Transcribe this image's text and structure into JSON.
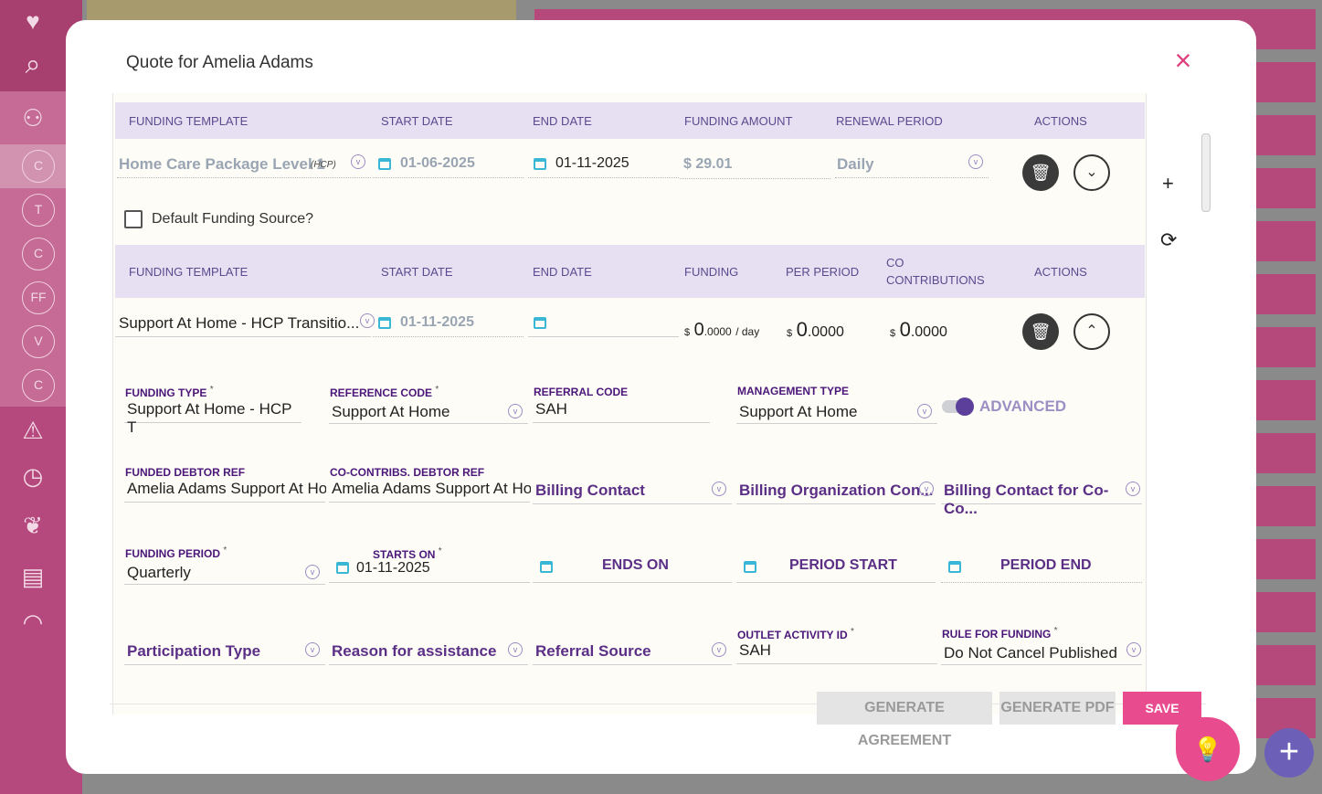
{
  "modal": {
    "title": "Quote for Amelia Adams",
    "close_icon": "×"
  },
  "sidebar": {
    "heart_icon": "♥",
    "search_icon": "⌕",
    "people_icon": "⚇",
    "circles": [
      "C",
      "T",
      "C",
      "FF",
      "V",
      "C"
    ],
    "warning_icon": "⚠",
    "clock_icon": "◷",
    "hearts_icon": "❦",
    "chat_icon": "▤",
    "gauge_icon": "◠"
  },
  "funding_header_1": {
    "template": "FUNDING TEMPLATE",
    "start": "START DATE",
    "end": "END DATE",
    "amount": "FUNDING AMOUNT",
    "renewal": "RENEWAL PERIOD",
    "actions": "ACTIONS"
  },
  "funding_row_1": {
    "template": "Home Care Package Level 1",
    "template_tag": "(HCP)",
    "start_date": "01-06-2025",
    "end_date": "01-11-2025",
    "amount": "$ 29.01",
    "renewal": "Daily",
    "delete_icon": "🗑",
    "toggle_icon": "⌄"
  },
  "default_funding_label": "Default Funding Source?",
  "funding_header_2": {
    "template": "FUNDING TEMPLATE",
    "start": "START DATE",
    "end": "END DATE",
    "funding": "FUNDING",
    "per_period": "PER PERIOD",
    "co_line1": "CO",
    "co_line2": "CONTRIBUTIONS",
    "actions": "ACTIONS"
  },
  "funding_row_2": {
    "template": "Support At Home - HCP Transitio...",
    "start_date": "01-11-2025",
    "end_date": "",
    "funding_currency": "$",
    "funding_int": "0",
    "funding_dec": ".0000",
    "funding_unit": "/ day",
    "per_period_currency": "$",
    "per_period_int": "0",
    "per_period_dec": ".0000",
    "co_currency": "$",
    "co_int": "0",
    "co_dec": ".0000",
    "delete_icon": "🗑",
    "toggle_icon": "⌃"
  },
  "details": {
    "funding_type_label": "FUNDING TYPE",
    "funding_type_value": "Support At Home - HCP T",
    "reference_code_label": "REFERENCE CODE",
    "reference_code_value": "Support At Home",
    "referral_code_label": "REFERRAL CODE",
    "referral_code_value": "SAH",
    "management_type_label": "MANAGEMENT TYPE",
    "management_type_value": "Support At Home",
    "advanced_label": "ADVANCED",
    "funded_debtor_label": "FUNDED DEBTOR REF",
    "funded_debtor_value": "Amelia Adams Support At Ho",
    "co_debtor_label": "CO-CONTRIBS. DEBTOR REF",
    "co_debtor_value": "Amelia Adams Support At Ho",
    "billing_contact": "Billing Contact",
    "billing_org": "Billing Organization Con...",
    "billing_co": "Billing Contact for Co-Co...",
    "funding_period_label": "FUNDING PERIOD",
    "funding_period_value": "Quarterly",
    "starts_on_label": "STARTS ON",
    "starts_on_value": "01-11-2025",
    "ends_on": "ENDS ON",
    "period_start": "PERIOD START",
    "period_end": "PERIOD END",
    "participation_type": "Participation Type",
    "reason": "Reason for assistance",
    "referral_source": "Referral Source",
    "outlet_label": "OUTLET ACTIVITY ID",
    "outlet_value": "SAH",
    "rule_label": "RULE FOR FUNDING",
    "rule_value": "Do Not Cancel Published ...",
    "required_mark": "*"
  },
  "side_tools": {
    "add_icon": "+",
    "refresh_icon": "⟳"
  },
  "footer": {
    "generate_agreement": "GENERATE AGREEMENT",
    "generate_pdf": "GENERATE PDF",
    "save": "SAVE"
  },
  "fab": {
    "bulb_icon": "💡",
    "plus_icon": "+"
  },
  "colors": {
    "accent_pink": "#e94b8f",
    "header_lavender": "#e6e0f2",
    "label_purple": "#4b167a",
    "sidebar_pink": "#b5487d"
  }
}
